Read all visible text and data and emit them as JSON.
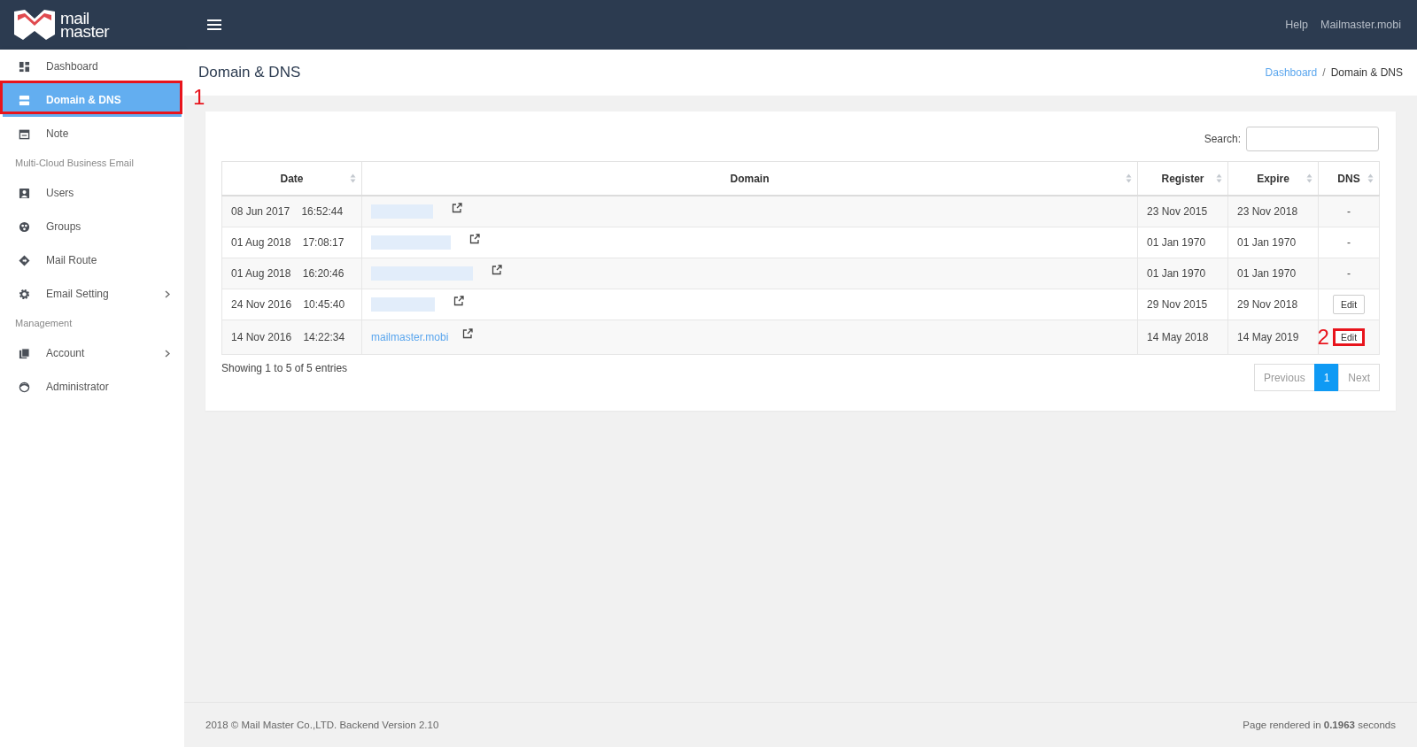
{
  "header": {
    "logo_text": [
      "mail",
      "master"
    ],
    "links": [
      "Help",
      "Mailmaster.mobi"
    ]
  },
  "sidebar": {
    "items": [
      {
        "kind": "item",
        "label": "Dashboard",
        "selected": false
      },
      {
        "kind": "item",
        "label": "Domain & DNS",
        "selected": true,
        "annotation": "1"
      },
      {
        "kind": "item",
        "label": "Note",
        "selected": false
      },
      {
        "kind": "section",
        "label": "Multi-Cloud Business Email"
      },
      {
        "kind": "item",
        "label": "Users",
        "selected": false
      },
      {
        "kind": "item",
        "label": "Groups",
        "selected": false
      },
      {
        "kind": "item",
        "label": "Mail Route",
        "selected": false
      },
      {
        "kind": "item",
        "label": "Email Setting",
        "selected": false,
        "submenu": true
      },
      {
        "kind": "section",
        "label": "Management"
      },
      {
        "kind": "item",
        "label": "Account",
        "selected": false,
        "submenu": true
      },
      {
        "kind": "item",
        "label": "Administrator",
        "selected": false
      }
    ]
  },
  "page": {
    "title": "Domain & DNS",
    "breadcrumb": [
      {
        "label": "Dashboard",
        "kind": "link"
      },
      {
        "label": "/",
        "kind": "sep"
      },
      {
        "label": "Domain & DNS",
        "kind": "current"
      }
    ]
  },
  "table": {
    "search_label": "Search:",
    "columns": [
      "Date",
      "Domain",
      "Register",
      "Expire",
      "DNS"
    ],
    "rows": [
      {
        "date": "08 Jun 2017",
        "time": "16:52:44",
        "domain": {
          "kind": "redacted"
        },
        "register": "23 Nov 2015",
        "expire": "23 Nov 2018",
        "dns": {
          "kind": "none",
          "text": "-"
        }
      },
      {
        "date": "01 Aug 2018",
        "time": "17:08:17",
        "domain": {
          "kind": "redacted"
        },
        "register": "01 Jan 1970",
        "expire": "01 Jan 1970",
        "dns": {
          "kind": "none",
          "text": "-"
        }
      },
      {
        "date": "01 Aug 2018",
        "time": "16:20:46",
        "domain": {
          "kind": "redacted"
        },
        "register": "01 Jan 1970",
        "expire": "01 Jan 1970",
        "dns": {
          "kind": "none",
          "text": "-"
        }
      },
      {
        "date": "24 Nov 2016",
        "time": "10:45:40",
        "domain": {
          "kind": "redacted"
        },
        "register": "29 Nov 2015",
        "expire": "29 Nov 2018",
        "dns": {
          "kind": "edit",
          "text": "Edit"
        }
      },
      {
        "date": "14 Nov 2016",
        "time": "14:22:34",
        "domain": {
          "kind": "link",
          "text": "mailmaster.mobi"
        },
        "register": "14 May 2018",
        "expire": "14 May 2019",
        "dns": {
          "kind": "edit",
          "text": "Edit",
          "annotation": "2"
        }
      }
    ],
    "info": "Showing 1 to 5 of 5 entries",
    "pagination": [
      {
        "label": "Previous",
        "selected": false
      },
      {
        "label": "1",
        "selected": true
      },
      {
        "label": "Next",
        "selected": false
      }
    ]
  },
  "footer": {
    "left": "2018 © Mail Master Co.,LTD. Backend Version 2.10",
    "right": "Page rendered in **0.1963** seconds"
  }
}
